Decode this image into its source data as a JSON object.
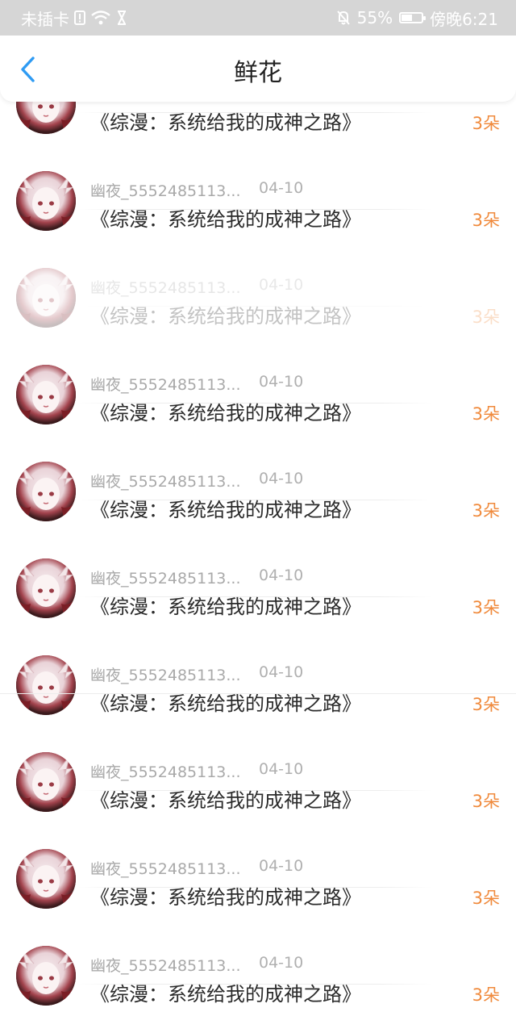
{
  "status_bar": {
    "carrier": "未插卡",
    "battery_percent": "55%",
    "battery_level": 0.55,
    "time": "傍晚6:21"
  },
  "header": {
    "title": "鲜花"
  },
  "colors": {
    "accent_blue": "#2f9bf3",
    "count_orange": "#f08a3c"
  },
  "items": [
    {
      "username": "",
      "date": "",
      "title": "《综漫：系统给我的成神之路》",
      "count": "3朵"
    },
    {
      "username": "幽夜_5552485113...",
      "date": "04-10",
      "title": "《综漫：系统给我的成神之路》",
      "count": "3朵"
    },
    {
      "username": "幽夜_5552485113...",
      "date": "04-10",
      "title": "《综漫：系统给我的成神之路》",
      "count": "3朵"
    },
    {
      "username": "幽夜_5552485113...",
      "date": "04-10",
      "title": "《综漫：系统给我的成神之路》",
      "count": "3朵"
    },
    {
      "username": "幽夜_5552485113...",
      "date": "04-10",
      "title": "《综漫：系统给我的成神之路》",
      "count": "3朵"
    },
    {
      "username": "幽夜_5552485113...",
      "date": "04-10",
      "title": "《综漫：系统给我的成神之路》",
      "count": "3朵"
    },
    {
      "username": "幽夜_5552485113...",
      "date": "04-10",
      "title": "《综漫：系统给我的成神之路》",
      "count": "3朵"
    },
    {
      "username": "幽夜_5552485113...",
      "date": "04-10",
      "title": "《综漫：系统给我的成神之路》",
      "count": "3朵"
    },
    {
      "username": "幽夜_5552485113...",
      "date": "04-10",
      "title": "《综漫：系统给我的成神之路》",
      "count": "3朵"
    },
    {
      "username": "幽夜_5552485113...",
      "date": "04-10",
      "title": "《综漫：系统给我的成神之路》",
      "count": "3朵"
    }
  ]
}
